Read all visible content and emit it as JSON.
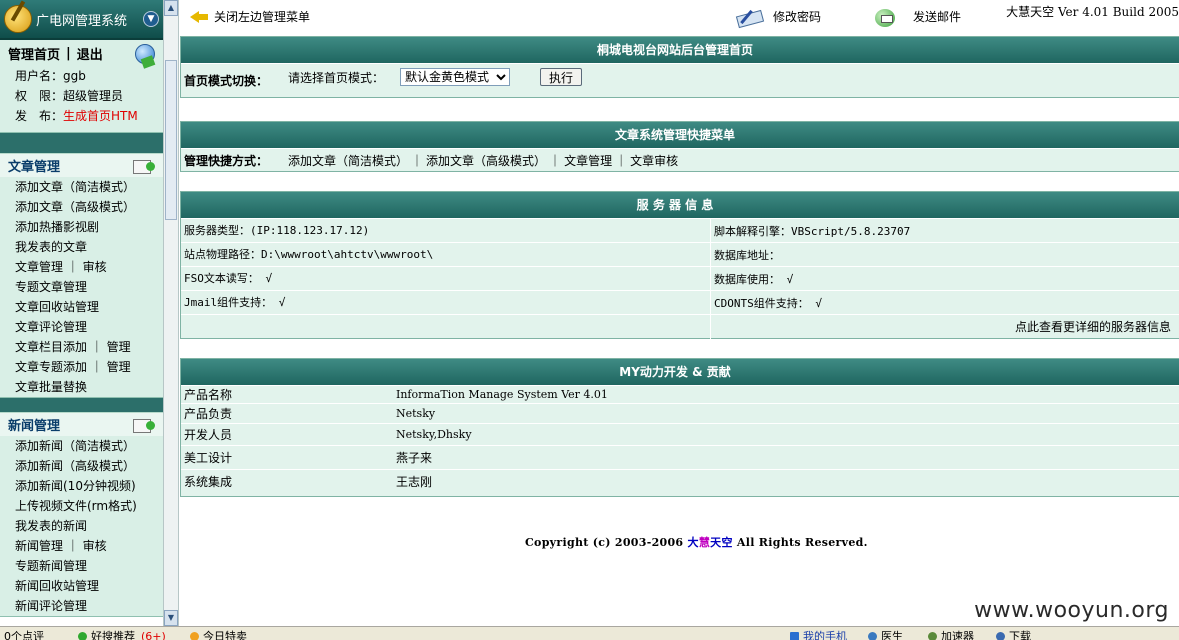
{
  "sidebar": {
    "title": "广电网管理系统",
    "user_links": {
      "home": "管理首页",
      "sep": "|",
      "logout": "退出"
    },
    "user_info": [
      {
        "label": "用户名：",
        "value": "ggb",
        "red": false
      },
      {
        "label": "权　限：",
        "value": "超级管理员",
        "red": false
      },
      {
        "label": "发　布：",
        "value": "生成首页HTM",
        "red": true
      }
    ],
    "sections": [
      {
        "title": "文章管理",
        "items": [
          "添加文章（简洁模式）",
          "添加文章（高级模式）",
          "添加热播影视剧",
          "我发表的文章",
          "文章管理 ｜ 审核",
          "专题文章管理",
          "文章回收站管理",
          "文章评论管理",
          "文章栏目添加 ｜ 管理",
          "文章专题添加 ｜ 管理",
          "文章批量替换"
        ]
      },
      {
        "title": "新闻管理",
        "items": [
          "添加新闻（简洁模式）",
          "添加新闻（高级模式）",
          "添加新闻(10分钟视频)",
          "上传视频文件(rm格式)",
          "我发表的新闻",
          "新闻管理 ｜ 审核",
          "专题新闻管理",
          "新闻回收站管理",
          "新闻评论管理"
        ]
      }
    ]
  },
  "topbar": {
    "close_menu": "关闭左边管理菜单",
    "change_password": "修改密码",
    "send_mail": "发送邮件",
    "version": "大慧天空 Ver 4.01 Build 2005"
  },
  "home_panel": {
    "title": "桐城电视台网站后台管理首页",
    "mode_label": "首页模式切换：",
    "select_prompt": "请选择首页模式：",
    "selected_mode": "默认金黄色模式",
    "exec_label": "执行"
  },
  "quick_panel": {
    "title": "文章系统管理快捷菜单",
    "label": "管理快捷方式：",
    "links": [
      "添加文章（简洁模式）",
      "添加文章（高级模式）",
      "文章管理",
      "文章审核"
    ],
    "sep": "｜"
  },
  "server_panel": {
    "title": "服 务 器 信 息",
    "rows": [
      [
        "服务器类型：(IP:118.123.17.12)",
        "脚本解释引擎：VBScript/5.8.23707"
      ],
      [
        "站点物理路径：D:\\wwwroot\\ahtctv\\wwwroot\\",
        "数据库地址："
      ],
      [
        "FSO文本读写： √",
        "数据库使用： √"
      ],
      [
        "Jmail组件支持： √",
        "CDONTS组件支持： √"
      ]
    ],
    "more_link": "点此查看更详细的服务器信息"
  },
  "credits_panel": {
    "title": "MY动力开发 & 贡献",
    "rows": [
      {
        "label": "产品名称",
        "value": "InformaTion Manage System Ver 4.01"
      },
      {
        "label": "产品负责",
        "value": "Netsky"
      },
      {
        "label": "开发人员",
        "value": "Netsky,Dhsky"
      },
      {
        "label": "美工设计",
        "value": "燕子来"
      },
      {
        "label": "系统集成",
        "value": "王志刚"
      }
    ]
  },
  "copyright": {
    "prefix": "Copyright (c) 2003-2006 ",
    "brand_1": "大",
    "brand_2": "慧",
    "brand_3": "天空",
    "suffix": " All Rights Reserved."
  },
  "watermark": "www.wooyun.org",
  "statusbar": {
    "comments": "0个点评",
    "recommend": "好搜推荐",
    "recommend_count": "(6+)",
    "today": "今日特卖",
    "phone": "我的手机",
    "doctor": "医生",
    "accelerator": "加速器",
    "download": "下载"
  },
  "colors": {
    "header_band": "#2c6f6a",
    "panel_bg": "#e2f3ec",
    "red_link": "#e00000"
  }
}
